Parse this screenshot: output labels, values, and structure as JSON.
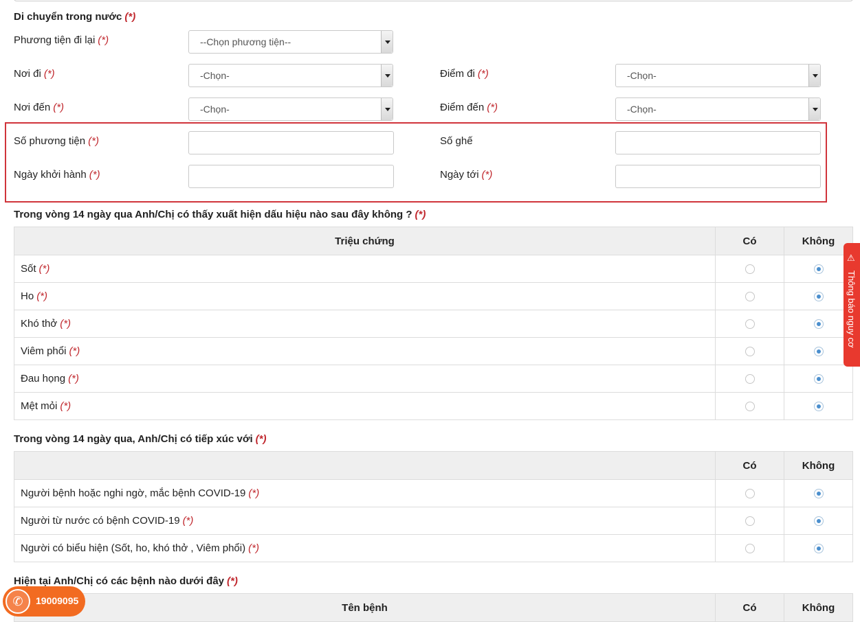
{
  "required_mark": "(*)",
  "domestic": {
    "title": "Di chuyển trong nước",
    "vehicle_label": "Phương tiện đi lại",
    "vehicle_placeholder": "--Chọn phương tiện--",
    "from_label": "Nơi đi",
    "from_value": "-Chọn-",
    "depart_point_label": "Điểm đi",
    "depart_point_value": "-Chọn-",
    "to_label": "Nơi đến",
    "to_value": "-Chọn-",
    "arrive_point_label": "Điểm đến",
    "arrive_point_value": "-Chọn-",
    "vehicle_number_label": "Số phương tiện",
    "vehicle_number_value": "",
    "seat_label": "Số ghế",
    "seat_value": "",
    "depart_date_label": "Ngày khởi hành",
    "depart_date_value": "",
    "arrive_date_label": "Ngày tới",
    "arrive_date_value": ""
  },
  "symptoms": {
    "title": "Trong vòng 14 ngày qua Anh/Chị có thấy xuất hiện dấu hiệu nào sau đây không ?",
    "col_name": "Triệu chứng",
    "col_yes": "Có",
    "col_no": "Không",
    "rows": [
      {
        "label": "Sốt",
        "answer": "Không"
      },
      {
        "label": "Ho",
        "answer": "Không"
      },
      {
        "label": "Khó thở",
        "answer": "Không"
      },
      {
        "label": "Viêm phổi",
        "answer": "Không"
      },
      {
        "label": "Đau họng",
        "answer": "Không"
      },
      {
        "label": "Mệt mỏi",
        "answer": "Không"
      }
    ]
  },
  "contact": {
    "title": "Trong vòng 14 ngày qua, Anh/Chị có tiếp xúc với",
    "col_name": "",
    "col_yes": "Có",
    "col_no": "Không",
    "rows": [
      {
        "label": "Người bệnh hoặc nghi ngờ, mắc bệnh COVID-19",
        "answer": "Không"
      },
      {
        "label": "Người từ nước có bệnh COVID-19",
        "answer": "Không"
      },
      {
        "label": "Người có biểu hiện (Sốt, ho, khó thở , Viêm phổi)",
        "answer": "Không"
      }
    ]
  },
  "diseases": {
    "title": "Hiện tại Anh/Chị có các bệnh nào dưới đây",
    "col_name": "Tên bệnh",
    "col_yes": "Có",
    "col_no": "Không"
  },
  "side_tab": {
    "label": "Thông báo nguy cơ",
    "icon": "alarm-icon"
  },
  "hotline": {
    "number": "19009095",
    "icon": "phone-icon"
  },
  "colors": {
    "required": "#c0272d",
    "highlight": "#d0333a",
    "side_tab": "#e8392e",
    "hotline": "#f26b21",
    "radio": "#4b8fce"
  }
}
